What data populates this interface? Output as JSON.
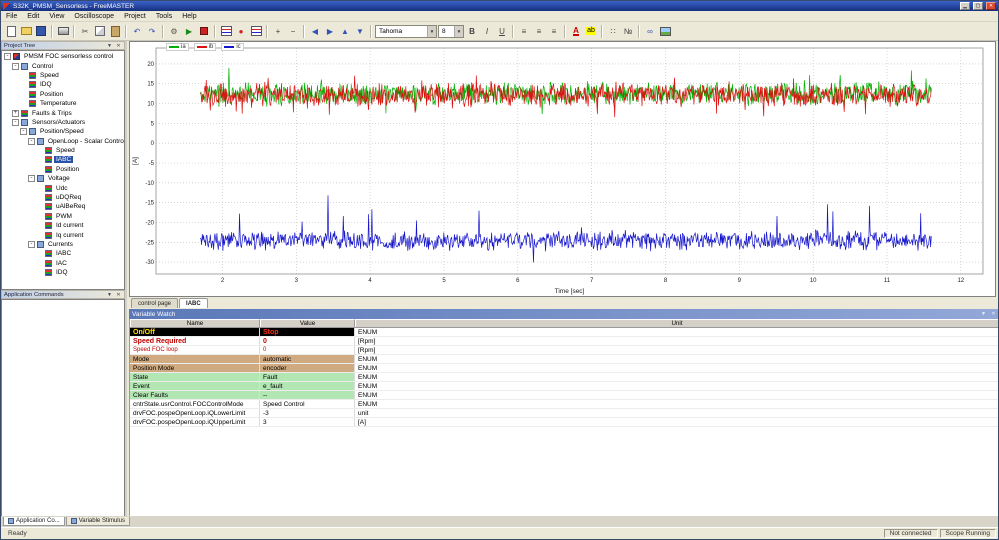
{
  "window": {
    "title": "S32K_PMSM_Sensorless - FreeMASTER"
  },
  "menu": {
    "items": [
      "File",
      "Edit",
      "View",
      "Oscilloscope",
      "Project",
      "Tools",
      "Help"
    ]
  },
  "toolbar": {
    "font_name": "Tahoma",
    "font_size": "8",
    "items": [
      {
        "name": "new-project-icon",
        "kind": "page"
      },
      {
        "name": "open-project-icon",
        "kind": "folder"
      },
      {
        "name": "save-project-icon",
        "kind": "floppy"
      },
      {
        "name": "sep"
      },
      {
        "name": "print-icon",
        "kind": "print"
      },
      {
        "name": "sep"
      },
      {
        "name": "cut-icon",
        "kind": "glyph",
        "glyph": "✂"
      },
      {
        "name": "copy-icon",
        "kind": "copy"
      },
      {
        "name": "paste-icon",
        "kind": "paste"
      },
      {
        "name": "sep"
      },
      {
        "name": "undo-icon",
        "kind": "glyph",
        "glyph": "↶",
        "color": "#3355bb"
      },
      {
        "name": "redo-icon",
        "kind": "glyph",
        "glyph": "↷",
        "color": "#3355bb"
      },
      {
        "name": "sep"
      },
      {
        "name": "project-options-icon",
        "kind": "glyph",
        "glyph": "⚙",
        "color": "#555555"
      },
      {
        "name": "start-communication-icon",
        "kind": "glyph",
        "glyph": "▶",
        "color": "#1a8a1a"
      },
      {
        "name": "stop-communication-icon",
        "kind": "stopsq"
      },
      {
        "name": "sep"
      },
      {
        "name": "new-scope-icon",
        "kind": "chart"
      },
      {
        "name": "new-recorder-icon",
        "kind": "glyph",
        "glyph": "●",
        "color": "#cc2222"
      },
      {
        "name": "variable-watch-icon",
        "kind": "chart"
      },
      {
        "name": "sep"
      },
      {
        "name": "zoom-in-icon",
        "kind": "glyph",
        "glyph": "+"
      },
      {
        "name": "zoom-out-icon",
        "kind": "glyph",
        "glyph": "−"
      },
      {
        "name": "sep"
      },
      {
        "name": "arrow-left-icon",
        "kind": "glyph",
        "glyph": "◀",
        "color": "#3355bb"
      },
      {
        "name": "arrow-right-icon",
        "kind": "glyph",
        "glyph": "▶",
        "color": "#3355bb"
      },
      {
        "name": "arrow-up-icon",
        "kind": "glyph",
        "glyph": "▲",
        "color": "#3355bb"
      },
      {
        "name": "arrow-down-icon",
        "kind": "glyph",
        "glyph": "▼",
        "color": "#3355bb"
      },
      {
        "name": "sep"
      }
    ],
    "format_items": [
      {
        "name": "bold-button",
        "kind": "glyph",
        "glyph": "B",
        "bold": true
      },
      {
        "name": "italic-button",
        "kind": "glyph",
        "glyph": "I",
        "italic": true
      },
      {
        "name": "underline-button",
        "kind": "glyph",
        "glyph": "U",
        "underline": true
      },
      {
        "name": "sep"
      },
      {
        "name": "align-left-icon",
        "kind": "glyph",
        "glyph": "≡"
      },
      {
        "name": "align-center-icon",
        "kind": "glyph",
        "glyph": "≡"
      },
      {
        "name": "align-right-icon",
        "kind": "glyph",
        "glyph": "≡"
      },
      {
        "name": "sep"
      },
      {
        "name": "text-color-icon",
        "kind": "colorA"
      },
      {
        "name": "highlight-color-icon",
        "kind": "highlight"
      },
      {
        "name": "sep"
      },
      {
        "name": "bullet-list-icon",
        "kind": "glyph",
        "glyph": "∷"
      },
      {
        "name": "numbered-list-icon",
        "kind": "glyph",
        "glyph": "№"
      },
      {
        "name": "sep"
      },
      {
        "name": "insert-link-icon",
        "kind": "glyph",
        "glyph": "∞",
        "color": "#3355bb"
      },
      {
        "name": "insert-image-icon",
        "kind": "img"
      }
    ]
  },
  "project_tree": {
    "title": "Project Tree",
    "root": {
      "label": "PMSM FOC sensorless control",
      "icon": "root",
      "expanded": true,
      "children": [
        {
          "label": "Control",
          "expanded": true,
          "children": [
            {
              "label": "Speed"
            },
            {
              "label": "IDQ"
            },
            {
              "label": "Position"
            },
            {
              "label": "Temperature"
            }
          ]
        },
        {
          "label": "Faults & Trips",
          "expanded": false,
          "expandable": true,
          "children": []
        },
        {
          "label": "Sensors/Actuators",
          "expanded": true,
          "children": [
            {
              "label": "Position/Speed",
              "expanded": true,
              "children": [
                {
                  "label": "OpenLoop - Scalar Control",
                  "expanded": true,
                  "children": [
                    {
                      "label": "Speed"
                    },
                    {
                      "label": "IABC",
                      "selected": true
                    },
                    {
                      "label": "Position"
                    }
                  ]
                },
                {
                  "label": "Voltage",
                  "expanded": true,
                  "children": [
                    {
                      "label": "Udc"
                    },
                    {
                      "label": "uDQReq"
                    },
                    {
                      "label": "uAlBeReq"
                    },
                    {
                      "label": "PWM"
                    },
                    {
                      "label": "Id current"
                    },
                    {
                      "label": "Iq current"
                    }
                  ]
                },
                {
                  "label": "Currents",
                  "expanded": true,
                  "children": [
                    {
                      "label": "IABC"
                    },
                    {
                      "label": "IAC"
                    },
                    {
                      "label": "IDQ"
                    }
                  ]
                }
              ]
            }
          ]
        }
      ]
    }
  },
  "application_commands": {
    "title": "Application Commands"
  },
  "scope_tabs": {
    "tabs": [
      {
        "label": "control page",
        "active": false
      },
      {
        "label": "IABC",
        "active": true
      }
    ]
  },
  "variable_watch": {
    "title": "Variable Watch",
    "columns": [
      "Name",
      "Value",
      "Unit"
    ],
    "rows": [
      {
        "name": "On/Off",
        "value": "Stop",
        "unit": "ENUM",
        "style": "onoff"
      },
      {
        "name": "Speed Required",
        "value": "0",
        "unit": "[Rpm]",
        "style": "speed-req"
      },
      {
        "name": "Speed FOC loop",
        "value": "0",
        "unit": "[Rpm]",
        "style": "speed-foc"
      },
      {
        "name": "Mode",
        "value": "automatic",
        "unit": "ENUM",
        "style": "tan"
      },
      {
        "name": "Position Mode",
        "value": "encoder",
        "unit": "ENUM",
        "style": "tan"
      },
      {
        "name": "State",
        "value": "Fault",
        "unit": "ENUM",
        "style": "green"
      },
      {
        "name": "Event",
        "value": "e_fault",
        "unit": "ENUM",
        "style": "green"
      },
      {
        "name": "Clear Faults",
        "value": "--",
        "unit": "ENUM",
        "style": "green"
      },
      {
        "name": "cntrState.usrControl.FOCControlMode",
        "value": "Speed Control",
        "unit": "ENUM",
        "style": "plain"
      },
      {
        "name": "drvFOC.pospeOpenLoop.iQLowerLimit",
        "value": "-3",
        "unit": "unit",
        "style": "plain"
      },
      {
        "name": "drvFOC.pospeOpenLoop.iQUpperLimit",
        "value": "3",
        "unit": "[A]",
        "style": "plain"
      }
    ]
  },
  "bottom_tabs": {
    "tabs": [
      {
        "label": "Application Co...",
        "active": true
      },
      {
        "label": "Variable Stimulus",
        "active": false
      }
    ]
  },
  "status_bar": {
    "left": "Ready",
    "connection": "Not connected",
    "scope": "Scope Running"
  },
  "chart_data": {
    "type": "line",
    "title": "",
    "xlabel": "Time [sec]",
    "ylabel": "[A]",
    "xlim": [
      1.1,
      12.3
    ],
    "ylim": [
      -33,
      24
    ],
    "x_ticks": [
      2,
      3,
      4,
      5,
      6,
      7,
      8,
      9,
      10,
      11,
      12
    ],
    "y_ticks": [
      20,
      15,
      10,
      5,
      0,
      -5,
      -10,
      -15,
      -20,
      -25,
      -30
    ],
    "grid": true,
    "legend_position": "top-left",
    "data_x_range": [
      1.7,
      11.6
    ],
    "points_per_series": 1100,
    "series": [
      {
        "name": "ia",
        "color": "#00b000",
        "mean": 12.4,
        "amp": 3.4,
        "spike_amp": 4.5,
        "spike_p": 0.04,
        "spike_bias": 0.5,
        "seed": 11
      },
      {
        "name": "ib",
        "color": "#dd1010",
        "mean": 12.2,
        "amp": 3.4,
        "spike_amp": 4.5,
        "spike_p": 0.04,
        "spike_bias": 0.5,
        "seed": 47
      },
      {
        "name": "ic",
        "color": "#1515cc",
        "mean": -24.6,
        "amp": 2.8,
        "spike_amp": 10,
        "spike_p": 0.015,
        "spike_bias": 0.85,
        "seed": 83
      }
    ]
  }
}
